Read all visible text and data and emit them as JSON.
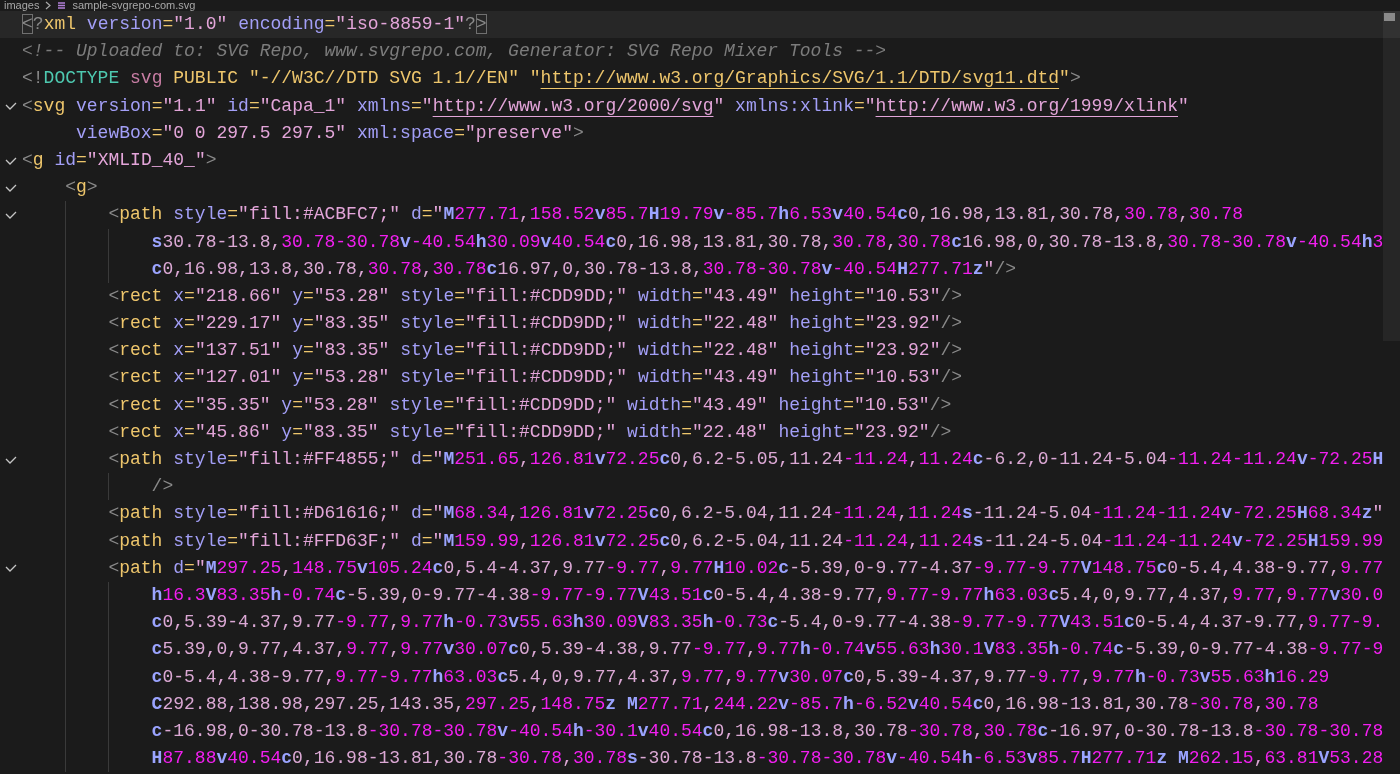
{
  "breadcrumb": [
    {
      "label": "images"
    },
    {
      "label": "sample-svgrepo-com.svg"
    }
  ],
  "lines": [
    {
      "kind": "tag",
      "text": "<?xml version=\"1.0\" encoding=\"iso-8859-1\"?>",
      "fold": false,
      "current": true
    },
    {
      "kind": "comment",
      "text": "<!-- Uploaded to: SVG Repo, www.svgrepo.com, Generator: SVG Repo Mixer Tools -->",
      "fold": false,
      "current": false
    },
    {
      "kind": "doctype",
      "text": "<!DOCTYPE svg PUBLIC \"-//W3C//DTD SVG 1.1//EN\" \"http://www.w3.org/Graphics/SVG/1.1/DTD/svg11.dtd\">",
      "fold": false,
      "current": false
    },
    {
      "kind": "tag",
      "text": "<svg version=\"1.1\" id=\"Capa_1\" xmlns=\"http://www.w3.org/2000/svg\" xmlns:xlink=\"http://www.w3.org/1999/xlink\"",
      "wrapped": [
        "viewBox=\"0 0 297.5 297.5\" xml:space=\"preserve\">"
      ],
      "fold": true,
      "current": false
    },
    {
      "kind": "tag",
      "text": "<g id=\"XMLID_40_\">",
      "fold": true,
      "current": false,
      "children": [
        {
          "kind": "tag",
          "text": "<g>",
          "fold": true,
          "current": false,
          "children": [
            {
              "kind": "tag",
              "text": "<path style=\"fill:#ACBFC7;\" d=\"M277.71,158.52v85.7H19.79v-85.7h6.53v40.54c0,16.98,13.81,30.78,30.78,30.78",
              "wrapped": [
                "s30.78-13.8,30.78-30.78v-40.54h30.09v40.54c0,16.98,13.81,30.78,30.78,30.78c16.98,0,30.78-13.8,30.78-30.78v-40.54h3",
                "c0,16.98,13.8,30.78,30.78,30.78c16.97,0,30.78-13.8,30.78-30.78v-40.54H277.71z\"/>"
              ],
              "fold": true,
              "current": false
            },
            {
              "kind": "tag",
              "text": "<rect x=\"218.66\" y=\"53.28\" style=\"fill:#CDD9DD;\" width=\"43.49\" height=\"10.53\"/>",
              "fold": false,
              "current": false
            },
            {
              "kind": "tag",
              "text": "<rect x=\"229.17\" y=\"83.35\" style=\"fill:#CDD9DD;\" width=\"22.48\" height=\"23.92\"/>",
              "fold": false,
              "current": false
            },
            {
              "kind": "tag",
              "text": "<rect x=\"137.51\" y=\"83.35\" style=\"fill:#CDD9DD;\" width=\"22.48\" height=\"23.92\"/>",
              "fold": false,
              "current": false
            },
            {
              "kind": "tag",
              "text": "<rect x=\"127.01\" y=\"53.28\" style=\"fill:#CDD9DD;\" width=\"43.49\" height=\"10.53\"/>",
              "fold": false,
              "current": false
            },
            {
              "kind": "tag",
              "text": "<rect x=\"35.35\" y=\"53.28\" style=\"fill:#CDD9DD;\" width=\"43.49\" height=\"10.53\"/>",
              "fold": false,
              "current": false
            },
            {
              "kind": "tag",
              "text": "<rect x=\"45.86\" y=\"83.35\" style=\"fill:#CDD9DD;\" width=\"22.48\" height=\"23.92\"/>",
              "fold": false,
              "current": false
            },
            {
              "kind": "tag",
              "text": "<path style=\"fill:#FF4855;\" d=\"M251.65,126.81v72.25c0,6.2-5.05,11.24-11.24,11.24c-6.2,0-11.24-5.04-11.24-11.24v-72.25H",
              "wrapped": [
                "/>"
              ],
              "fold": true,
              "current": false
            },
            {
              "kind": "tag",
              "text": "<path style=\"fill:#D61616;\" d=\"M68.34,126.81v72.25c0,6.2-5.04,11.24-11.24,11.24s-11.24-5.04-11.24-11.24v-72.25H68.34z\"",
              "fold": false,
              "current": false
            },
            {
              "kind": "tag",
              "text": "<path style=\"fill:#FFD63F;\" d=\"M159.99,126.81v72.25c0,6.2-5.04,11.24-11.24,11.24s-11.24-5.04-11.24-11.24v-72.25H159.99",
              "fold": false,
              "current": false
            },
            {
              "kind": "tag",
              "text": "<path d=\"M297.25,148.75v105.24c0,5.4-4.37,9.77-9.77,9.77H10.02c-5.39,0-9.77-4.37-9.77-9.77V148.75c0-5.4,4.38-9.77,9.77",
              "wrapped": [
                "h16.3V83.35h-0.74c-5.39,0-9.77-4.38-9.77-9.77V43.51c0-5.4,4.38-9.77,9.77-9.77h63.03c5.4,0,9.77,4.37,9.77,9.77v30.0",
                "c0,5.39-4.37,9.77-9.77,9.77h-0.73v55.63h30.09V83.35h-0.73c-5.4,0-9.77-4.38-9.77-9.77V43.51c0-5.4,4.37-9.77,9.77-9.",
                "c5.39,0,9.77,4.37,9.77,9.77v30.07c0,5.39-4.38,9.77-9.77,9.77h-0.74v55.63h30.1V83.35h-0.74c-5.39,0-9.77-4.38-9.77-9",
                "c0-5.4,4.38-9.77,9.77-9.77h63.03c5.4,0,9.77,4.37,9.77,9.77v30.07c0,5.39-4.37,9.77-9.77,9.77h-0.73v55.63h16.29",
                "C292.88,138.98,297.25,143.35,297.25,148.75z M277.71,244.22v-85.7h-6.52v40.54c0,16.98-13.81,30.78-30.78,30.78",
                "c-16.98,0-30.78-13.8-30.78-30.78v-40.54h-30.1v40.54c0,16.98-13.8,30.78-30.78,30.78c-16.97,0-30.78-13.8-30.78-30.78",
                "H87.88v40.54c0,16.98-13.81,30.78-30.78,30.78s-30.78-13.8-30.78-30.78v-40.54h-6.53v85.7H277.71z M262.15,63.81V53.28"
              ],
              "fold": true,
              "current": false
            }
          ]
        }
      ]
    }
  ]
}
